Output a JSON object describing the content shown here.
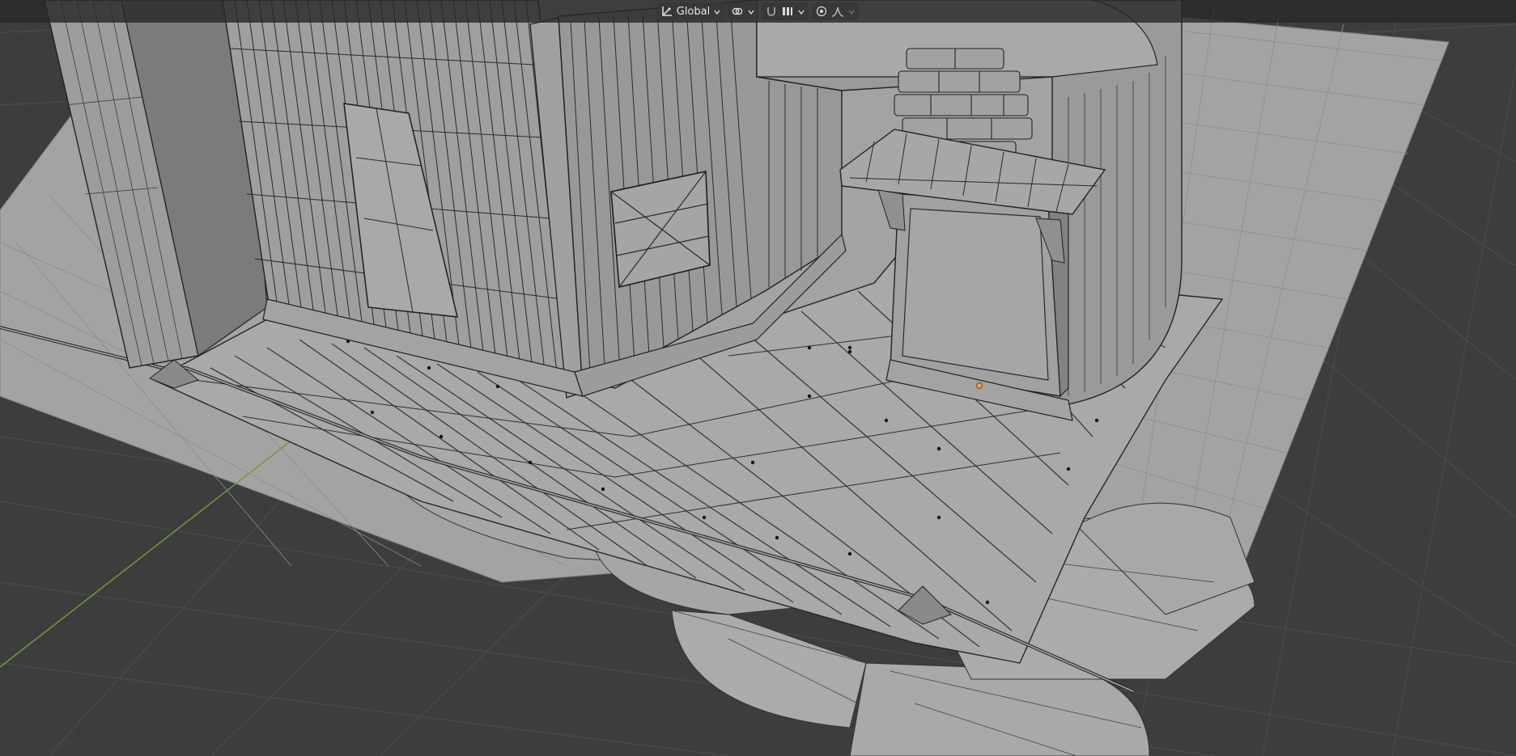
{
  "header": {
    "orientation_icon": "transform-orientation-icon",
    "orientation_label": "Global",
    "pivot_icon": "link-pivot-icon",
    "snap_icon": "snap-magnet-icon",
    "snap_target_icon": "snap-increment-icon",
    "proportional_icon": "proportional-edit-icon",
    "falloff_icon": "falloff-curve-icon"
  },
  "colors": {
    "bg": "#3d3d3d",
    "grid_line": "#4d4d4d",
    "ground": "#a4a4a4",
    "mesh_light": "#9a9a9a",
    "wire": "#1e1e1e",
    "y_axis": "#6c9a3a"
  }
}
